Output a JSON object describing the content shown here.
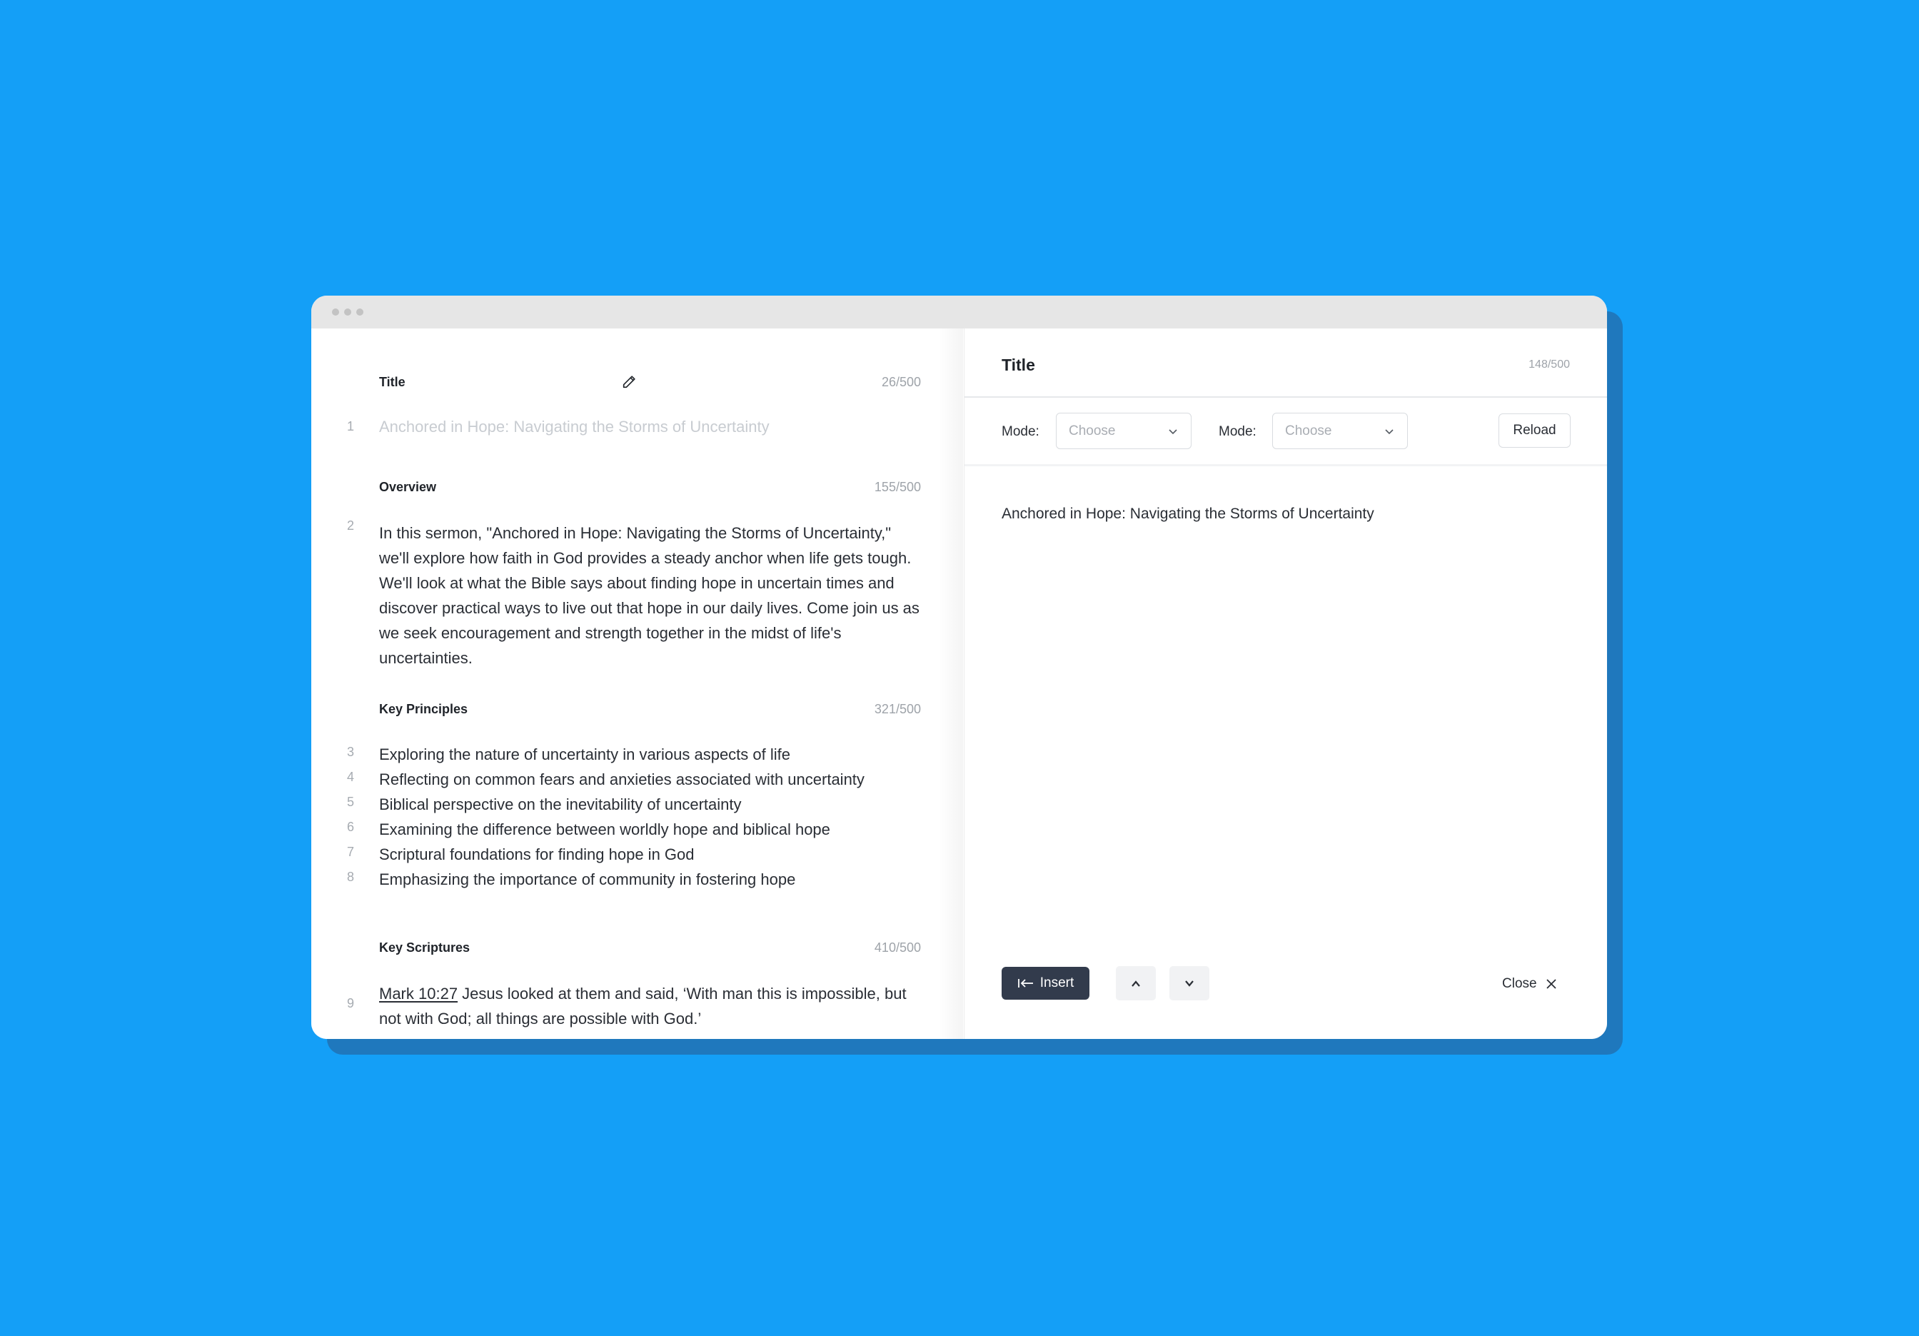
{
  "colors": {
    "background": "#149ff7",
    "window_shadow": "#1f78bd",
    "titlebar": "#e6e6e6",
    "insert_button": "#323b4c",
    "text": "#2a2e35",
    "muted": "#9ea3a9"
  },
  "titlebar": {
    "dots_icon": "window-controls-dots"
  },
  "editor": {
    "title_section": {
      "label": "Title",
      "edit_icon": "pencil-icon",
      "counter": "26/500",
      "line_number": "1",
      "text": "Anchored in Hope: Navigating the Storms of Uncertainty"
    },
    "overview": {
      "label": "Overview",
      "counter": "155/500",
      "line_number": "2",
      "text": "In this sermon, \"Anchored in Hope: Navigating the Storms of Uncertainty,\" we'll explore how faith in God provides a steady anchor when life gets tough. We'll look at what the Bible says about finding hope in uncertain times and discover practical ways to live out that hope in our daily lives. Come join us as we seek encouragement and strength together in the midst of life's uncertainties."
    },
    "key_principles": {
      "label": "Key Principles",
      "counter": "321/500",
      "items": [
        {
          "num": "3",
          "text": "Exploring the nature of uncertainty in various aspects of life"
        },
        {
          "num": "4",
          "text": "Reflecting on common fears and anxieties associated with uncertainty"
        },
        {
          "num": "5",
          "text": "Biblical perspective on the inevitability of uncertainty"
        },
        {
          "num": "6",
          "text": "Examining the difference between worldly hope and biblical hope"
        },
        {
          "num": "7",
          "text": "Scriptural foundations for finding hope in God"
        },
        {
          "num": "8",
          "text": "Emphasizing the importance of community in fostering hope"
        }
      ]
    },
    "key_scriptures": {
      "label": "Key Scriptures",
      "counter": "410/500",
      "line_number": "9",
      "reference": "Mark 10:27",
      "text": " Jesus looked at them and said, ‘With man this is impossible, but not with God; all things are possible with God.’"
    }
  },
  "preview": {
    "title": "Title",
    "counter": "148/500",
    "toolbar": {
      "dropdowns": [
        {
          "label": "Mode:",
          "placeholder": "Choose",
          "icon": "chevron-down-icon"
        },
        {
          "label": "Mode:",
          "placeholder": "Choose",
          "icon": "chevron-down-icon"
        }
      ],
      "reload_label": "Reload"
    },
    "content": "Anchored in Hope: Navigating the Storms of Uncertainty",
    "footer": {
      "insert_label": "Insert",
      "insert_icon": "insert-left-arrow-icon",
      "up_icon": "chevron-up-icon",
      "down_icon": "chevron-down-icon",
      "close_label": "Close",
      "close_icon": "close-icon"
    }
  }
}
